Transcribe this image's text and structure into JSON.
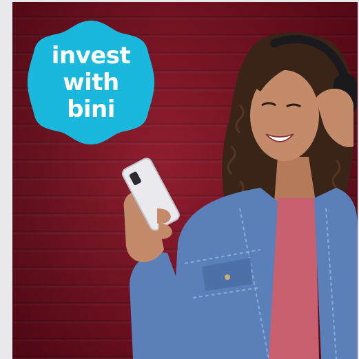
{
  "badge": {
    "lines": [
      "invest",
      "with",
      "bini"
    ],
    "color": "#1ab8dc"
  },
  "photo": {
    "background_color": "#7d0e20",
    "subject": "smiling woman with headphones holding a smartphone"
  },
  "colors": {
    "frame": "#e8e8ea",
    "denim": "#5b7fb8",
    "shirt": "#c9606f",
    "hair": "#3a2418",
    "skin": "#c48b6a",
    "phone": "#e9e9ee",
    "headphones": "#1a1a1e"
  }
}
